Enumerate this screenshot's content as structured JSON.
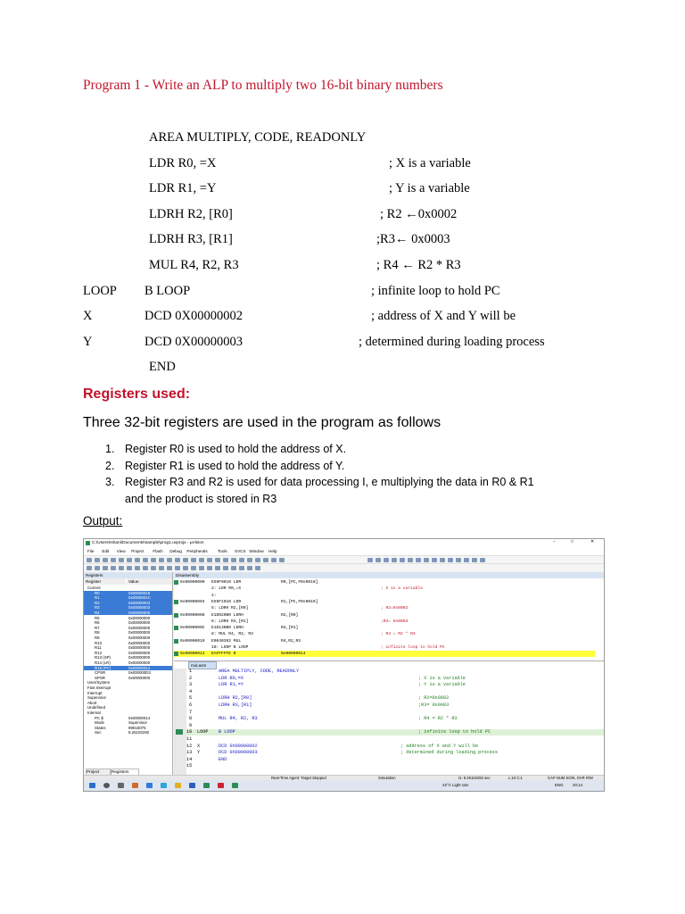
{
  "title": "Program 1 - Write an ALP to multiply two 16-bit binary numbers",
  "code_lines": [
    {
      "label": "",
      "instr": "AREA MULTIPLY, CODE, READONLY",
      "comment": ""
    },
    {
      "label": "",
      "instr": "LDR R0, =X",
      "comment": "; X is a variable"
    },
    {
      "label": "",
      "instr": "LDR R1, =Y",
      "comment": "; Y is a variable"
    },
    {
      "label": "",
      "instr": "LDRH R2, [R0]",
      "comment": "; R2 ←0x0002"
    },
    {
      "label": "",
      "instr": "LDRH R3, [R1]",
      "comment": ";R3← 0x0003"
    },
    {
      "label": "",
      "instr": "MUL R4, R2, R3",
      "comment": "; R4 ← R2 * R3"
    },
    {
      "label": "LOOP",
      "instr": "B   LOOP",
      "comment": "; infinite loop to hold PC"
    },
    {
      "label": "X",
      "instr": "DCD    0X00000002",
      "comment": "; address of X and Y will be"
    },
    {
      "label": "Y",
      "instr": "DCD    0X00000003",
      "comment": "; determined during loading process"
    },
    {
      "label": "",
      "instr": "END",
      "comment": ""
    }
  ],
  "registers_heading": "Registers used:",
  "intro": "Three 32-bit registers are used in the program as follows",
  "list": [
    {
      "num": "1.",
      "text": "Register R0 is used to hold the address of X."
    },
    {
      "num": "2.",
      "text": "Register R1 is used to hold the address of Y."
    },
    {
      "num": "3.",
      "text": "Register R3 and R2 is used for data processing I, e multiplying the data in R0 & R1"
    },
    {
      "num": "",
      "text": "and the product is stored in R3"
    }
  ],
  "output_label": "Output:",
  "screenshot": {
    "window_title": "C:\\Users\\Ishani\\Documents\\sample\\prog1.uvprojx - µVision",
    "window_controls": [
      "–",
      "□",
      "✕"
    ],
    "menu": [
      "File",
      "Edit",
      "View",
      "Project",
      "Flash",
      "Debug",
      "Peripherals",
      "Tools",
      "SVCS",
      "Window",
      "Help"
    ],
    "registers_pane_title": "Registers",
    "registers_columns": [
      "Register",
      "Value"
    ],
    "registers": [
      {
        "name": "Current",
        "value": ""
      },
      {
        "name": "R0",
        "value": "0x00000018"
      },
      {
        "name": "R1",
        "value": "0x0000001C"
      },
      {
        "name": "R2",
        "value": "0x00000002"
      },
      {
        "name": "R3",
        "value": "0x00000003"
      },
      {
        "name": "R4",
        "value": "0x00000006"
      },
      {
        "name": "R5",
        "value": "0x00000000"
      },
      {
        "name": "R6",
        "value": "0x00000000"
      },
      {
        "name": "R7",
        "value": "0x00000000"
      },
      {
        "name": "R8",
        "value": "0x00000000"
      },
      {
        "name": "R9",
        "value": "0x00000000"
      },
      {
        "name": "R10",
        "value": "0x00000000"
      },
      {
        "name": "R11",
        "value": "0x00000000"
      },
      {
        "name": "R12",
        "value": "0x00000000"
      },
      {
        "name": "R13 (SP)",
        "value": "0x00000000"
      },
      {
        "name": "R14 (LR)",
        "value": "0x00000000"
      },
      {
        "name": "R15 (PC)",
        "value": "0x00000014"
      },
      {
        "name": "CPSR",
        "value": "0x000000D3"
      },
      {
        "name": "SPSR",
        "value": "0x00000000"
      },
      {
        "name": "User/System",
        "value": ""
      },
      {
        "name": "Fast Interrupt",
        "value": ""
      },
      {
        "name": "Interrupt",
        "value": ""
      },
      {
        "name": "Supervisor",
        "value": ""
      },
      {
        "name": "Abort",
        "value": ""
      },
      {
        "name": "Undefined",
        "value": ""
      },
      {
        "name": "Internal",
        "value": ""
      },
      {
        "name": "PC $",
        "value": "0x00000014"
      },
      {
        "name": "Mode",
        "value": "Supervisor"
      },
      {
        "name": "States",
        "value": "99015075"
      },
      {
        "name": "Sec",
        "value": "8.25102292"
      }
    ],
    "bottom_tabs": [
      "Project",
      "Registers"
    ],
    "disassembly_title": "Disassembly",
    "disassembly": [
      {
        "addr": "0x00000000",
        "op": "E59F0010  LDR",
        "args": "R0,[PC,#0x0010]",
        "cmt": ""
      },
      {
        "addr": "",
        "op": "2:    LDR R0,=X",
        "args": "",
        "cmt": "; X is a variable"
      },
      {
        "addr": "",
        "op": "4:",
        "args": "",
        "cmt": ""
      },
      {
        "addr": "0x00000004",
        "op": "E59F1010  LDR",
        "args": "R1,[PC,#0x0010]",
        "cmt": ""
      },
      {
        "addr": "",
        "op": "5:    LDRH R2,[R0]",
        "args": "",
        "cmt": "; R2=0x0002"
      },
      {
        "addr": "0x00000008",
        "op": "E1D020B0  LDRH",
        "args": "R2,[R0]",
        "cmt": ""
      },
      {
        "addr": "",
        "op": "6:    LDRH R3,[R1]",
        "args": "",
        "cmt": ";R3= 0x0003"
      },
      {
        "addr": "0x0000000C",
        "op": "E1D130B0  LDRH",
        "args": "R3,[R1]",
        "cmt": ""
      },
      {
        "addr": "",
        "op": "8:    MUL R4, R2, R3",
        "args": "",
        "cmt": "; R4 = R2 * R3"
      },
      {
        "addr": "0x00000010",
        "op": "E0040392  MUL",
        "args": "R4,R2,R3",
        "cmt": ""
      },
      {
        "addr": "",
        "op": "10: LOOP      B    LOOP",
        "args": "",
        "cmt": "; infinite loop to hold PC"
      },
      {
        "addr": "0x00000014",
        "op": "EAFFFFFE  B",
        "args": "0x00000014",
        "cmt": ""
      }
    ],
    "source_tab": "mul.asm",
    "source": [
      {
        "ln": "1",
        "label": "",
        "instr": "AREA MULTIPLY, CODE, READONLY",
        "cmt": ""
      },
      {
        "ln": "2",
        "label": "",
        "instr": "LDR R0,=X",
        "cmt": "; X is a variable"
      },
      {
        "ln": "3",
        "label": "",
        "instr": "LDR R1,=Y",
        "cmt": "; Y is a variable"
      },
      {
        "ln": "4",
        "label": "",
        "instr": "",
        "cmt": ""
      },
      {
        "ln": "5",
        "label": "",
        "instr": "LDRH R2,[R0]",
        "cmt": "; R2=0x0002"
      },
      {
        "ln": "6",
        "label": "",
        "instr": "LDRH R3,[R1]",
        "cmt": ";R3= 0x0003"
      },
      {
        "ln": "7",
        "label": "",
        "instr": "",
        "cmt": ""
      },
      {
        "ln": "8",
        "label": "",
        "instr": "MUL R4, R2, R3",
        "cmt": "; R4 = R2 * R3"
      },
      {
        "ln": "9",
        "label": "",
        "instr": "",
        "cmt": ""
      },
      {
        "ln": "10",
        "label": "LOOP",
        "instr": "B    LOOP",
        "cmt": "; infinite loop to hold PC"
      },
      {
        "ln": "11",
        "label": "",
        "instr": "",
        "cmt": ""
      },
      {
        "ln": "12",
        "label": "X",
        "instr": "DCD    0X00000002",
        "cmt": "; address of X and Y will be"
      },
      {
        "ln": "13",
        "label": "Y",
        "instr": "DCD    0X00000003",
        "cmt": "; determined during loading process"
      },
      {
        "ln": "14",
        "label": "",
        "instr": "END",
        "cmt": ""
      },
      {
        "ln": "15",
        "label": "",
        "instr": "",
        "cmt": ""
      }
    ],
    "status": {
      "agent": "Real-Time Agent: Target Stopped",
      "mode": "Simulation",
      "time": "t1: 8.25102292 sec",
      "pos": "L:10 C:1",
      "flags": "CAP  NUM  SCRL  OVR  R/W"
    },
    "taskbar": {
      "weather": "22°C  Light rain",
      "lang": "ENG",
      "clock": "20:14"
    },
    "colors": {
      "selected_row": "#3a7bd5",
      "current_line": "#ffff3a",
      "keyword": "#1a1ac8"
    }
  }
}
